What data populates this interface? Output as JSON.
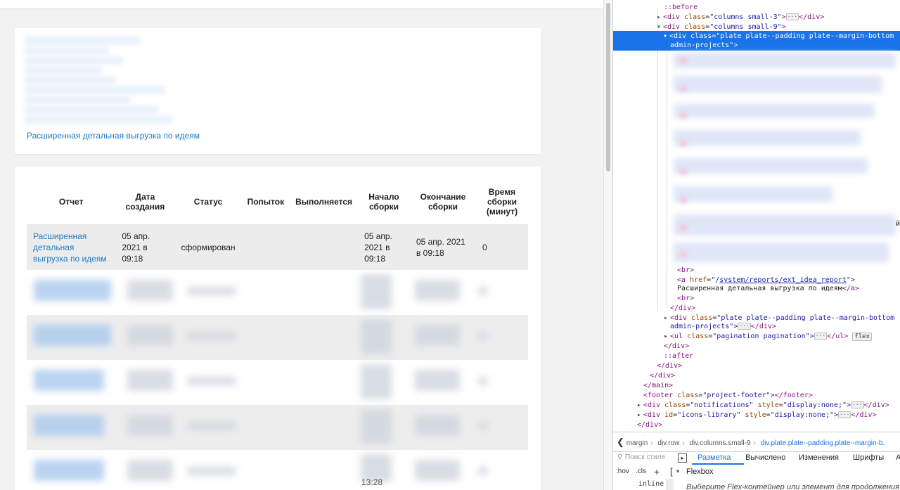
{
  "page": {
    "plate1_link": "Расширенная детальная выгрузка по идеям",
    "table": {
      "headers": [
        "Отчет",
        "Дата создания",
        "Статус",
        "Попыток",
        "Выполняется",
        "Начало сборки",
        "Окончание сборки",
        "Время сборки (минут)"
      ],
      "row1": {
        "report": "Расширенная детальная выгрузка по идеям",
        "created": "05 апр. 2021 в 09:18",
        "status": "сформирован",
        "attempts": "",
        "running": "",
        "start": "05 апр. 2021 в 09:18",
        "end": "05 апр. 2021 в 09:18",
        "minutes": "0"
      },
      "partial_bottom_text": "13:28"
    }
  },
  "devtools": {
    "lines": {
      "before_top": "::before",
      "cols3_tag": "<div",
      "cols3_attr": "class",
      "cols3_val": "\"columns small-3\"",
      "cols3_close": "</div>",
      "cols9_tag": "<div",
      "cols9_attr": "class",
      "cols9_val": "\"columns small-9\"",
      "sel_tag": "<div",
      "sel_attr": "class",
      "sel_val1": "\"plate plate--padding plate--margin-bottom",
      "sel_val2": "admin-projects\">",
      "br1": "<br>",
      "a_open": "<a",
      "a_attr": "href",
      "a_href_prefix": "\"/",
      "a_href_path": "system/reports/ext_idea_report",
      "a_href_suffix": "\">",
      "a_text": "Расширенная детальная выгрузка по идеям",
      "a_close": "</a>",
      "br2": "<br>",
      "div_close1": "</div>",
      "div2_tag": "<div",
      "div2_attr": "class",
      "div2_val1": "\"plate plate--padding plate--margin-bottom",
      "div2_val2": "admin-projects\">",
      "div2_close": "</div>",
      "ul_tag": "<ul",
      "ul_attr": "class",
      "ul_val": "\"pagination pagination\">",
      "ul_close": "</ul>",
      "ul_badge": "flex",
      "div_close2": "</div>",
      "after": "::after",
      "div_close3": "</div>",
      "div_close4": "</div>",
      "main_close": "</main>",
      "footer_tag": "<footer",
      "footer_attr": "class",
      "footer_val": "\"project-footer\">",
      "footer_close": "</footer>",
      "notif_tag": "<div",
      "notif_attr1": "class",
      "notif_val1": "\"notifications\"",
      "notif_attr2": "style",
      "notif_val2": "\"display:none;\">",
      "notif_close": "</div>",
      "icons_tag": "<div",
      "icons_attr1": "id",
      "icons_val1": "\"icons-library\"",
      "icons_attr2": "style",
      "icons_val2": "\"display:none;\">",
      "icons_close": "</div>",
      "div_close5": "</div>",
      "edge_letter": "й"
    },
    "breadcrumbs": {
      "back": "❮",
      "items": [
        "margin",
        "div.row",
        "div.columns.small-9",
        "div.plate.plate--padding.plate--margin-b."
      ]
    },
    "styles_filter_placeholder": "Поиск стиле",
    "tabs": [
      "Разметка",
      "Вычислено",
      "Изменения",
      "Шрифты",
      "А"
    ],
    "hov": ":hov",
    "cls": ".cls",
    "plus": "+",
    "flexbox_label": "Flexbox",
    "inline_label": "inline",
    "flex_hint": "Выберите Flex-контейнер или элемент для продолжения"
  }
}
